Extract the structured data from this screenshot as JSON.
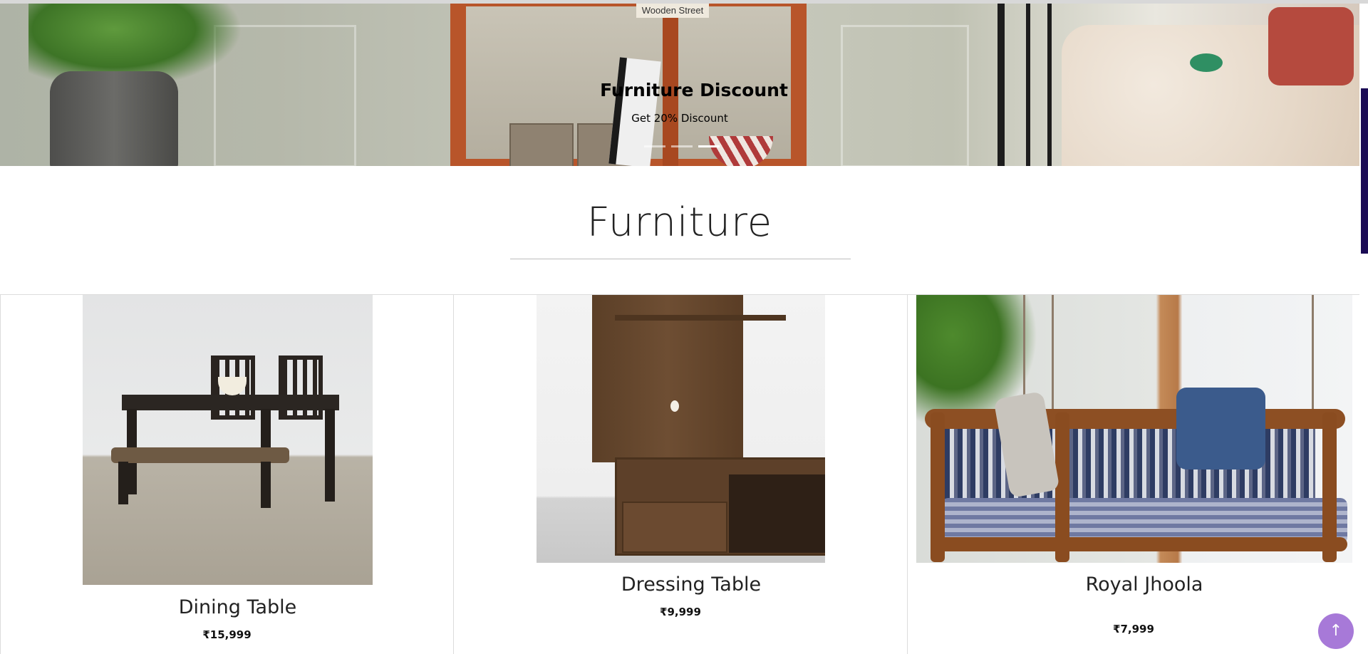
{
  "hero": {
    "title": "Furniture Discount",
    "subtitle": "Get 20% Discount",
    "shelf_label": "Wooden Street",
    "slides": [
      "slide-1",
      "slide-2",
      "slide-3"
    ],
    "active_slide": 3
  },
  "section": {
    "title": "Furniture"
  },
  "products": [
    {
      "name": "Dining Table",
      "price": "₹15,999"
    },
    {
      "name": "Dressing Table",
      "price": "₹9,999"
    },
    {
      "name": "Royal Jhoola",
      "price": "₹7,999"
    }
  ],
  "back_to_top": {
    "icon": "arrow-up-icon",
    "glyph": "↑",
    "color": "#a779d8"
  },
  "scrollbar": {
    "thumb_color": "#1b0b55"
  }
}
